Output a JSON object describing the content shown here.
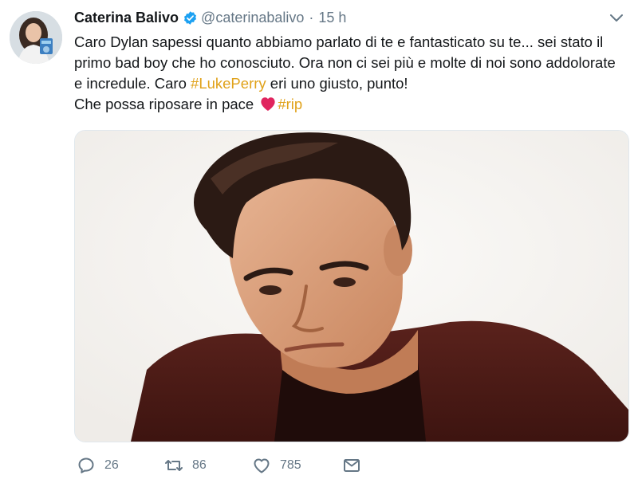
{
  "author": {
    "name": "Caterina Balivo",
    "handle": "@caterinabalivo",
    "separator": "·",
    "time": "15 h"
  },
  "tweet": {
    "line1": "Caro Dylan sapessi quanto abbiamo parlato di te e fantasticato su te... sei stato il primo bad boy che ho conosciuto. Ora non ci sei più e molte di noi sono addolorate e incredule. Caro ",
    "hashtag1": "#LukePerry",
    "line2": " eri uno giusto, punto!",
    "line3": "Che possa riposare in pace ",
    "hashtag2": "#rip"
  },
  "actions": {
    "replies": "26",
    "retweets": "86",
    "likes": "785"
  },
  "colors": {
    "hashtag": "#e0a21a",
    "verified": "#1da1f2",
    "muted": "#657786",
    "heart": "#e0245e"
  },
  "icons": {
    "verified": "verified-badge-icon",
    "caret": "chevron-down-icon",
    "heart_emoji": "red-heart-icon",
    "reply": "reply-icon",
    "retweet": "retweet-icon",
    "like": "like-icon",
    "message": "direct-message-icon"
  }
}
